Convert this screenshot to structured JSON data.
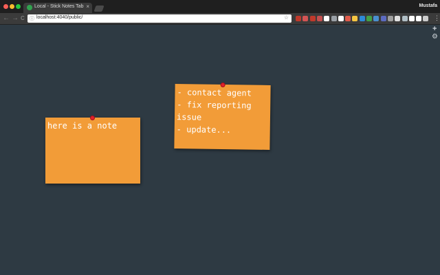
{
  "browser": {
    "tab": {
      "title": "Local - Stick Notes Tab",
      "close": "×"
    },
    "profile": "Mustafa",
    "address_bar": {
      "url": "localhost:4040/public/",
      "info": "ⓘ",
      "star": "☆"
    },
    "nav": {
      "back": "←",
      "forward": "→",
      "reload": "C"
    },
    "menu": "⋮",
    "extension_colors": [
      "#c0392b",
      "#d35454",
      "#c0392b",
      "#c44f4f",
      "#ffffff",
      "#9aa0a6",
      "#ffffff",
      "#e05b4b",
      "#f5c542",
      "#2e89d6",
      "#43a047",
      "#4a8fcf",
      "#5c6bc0",
      "#9e9e9e",
      "#e0e0e0",
      "#b0bec5",
      "#ffffff",
      "#ffffff",
      "#cccccc"
    ]
  },
  "sidebar": {
    "add": "+",
    "settings": "⚙"
  },
  "notes": [
    {
      "text": "here is a note"
    },
    {
      "text": "- contact agent\n- fix reporting issue\n- update..."
    }
  ],
  "colors": {
    "background": "#2e3a43",
    "note": "#f29c38",
    "pin": "#e0212b"
  }
}
